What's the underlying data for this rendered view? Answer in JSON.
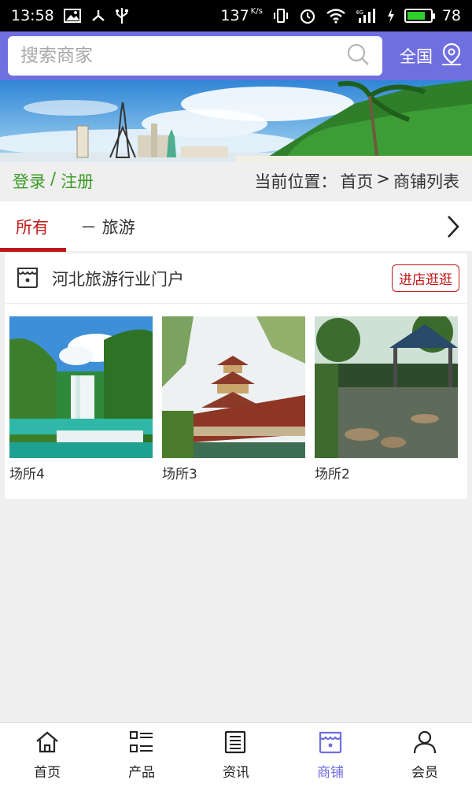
{
  "status_bar": {
    "time": "13:58",
    "net_speed": "137",
    "net_speed_unit": "K/s",
    "battery": "78"
  },
  "search": {
    "placeholder": "搜索商家"
  },
  "region": {
    "label": "全国"
  },
  "location_bar": {
    "login": "登录",
    "sep": "/",
    "register": "注册",
    "current_label": "当前位置：",
    "home": "首页",
    "arrow": ">",
    "page": "商铺列表"
  },
  "tabs": [
    {
      "label": "所有",
      "active": true
    },
    {
      "label": "－ 旅游",
      "active": false
    }
  ],
  "shop": {
    "name": "河北旅游行业门户",
    "enter_button": "进店逛逛",
    "items": [
      {
        "label": "场所4",
        "image": "waterfall"
      },
      {
        "label": "场所3",
        "image": "pagoda-bridge"
      },
      {
        "label": "场所2",
        "image": "pond-pavilion"
      }
    ]
  },
  "bottom_nav": [
    {
      "label": "首页",
      "icon": "home-icon",
      "active": false
    },
    {
      "label": "产品",
      "icon": "list-icon",
      "active": false
    },
    {
      "label": "资讯",
      "icon": "news-icon",
      "active": false
    },
    {
      "label": "商铺",
      "icon": "store-icon",
      "active": true
    },
    {
      "label": "会员",
      "icon": "user-icon",
      "active": false
    }
  ],
  "colors": {
    "header_bg": "#6f6fe0",
    "accent_red": "#c01818",
    "auth_green": "#3c9a27",
    "nav_active": "#6f6fe0"
  }
}
